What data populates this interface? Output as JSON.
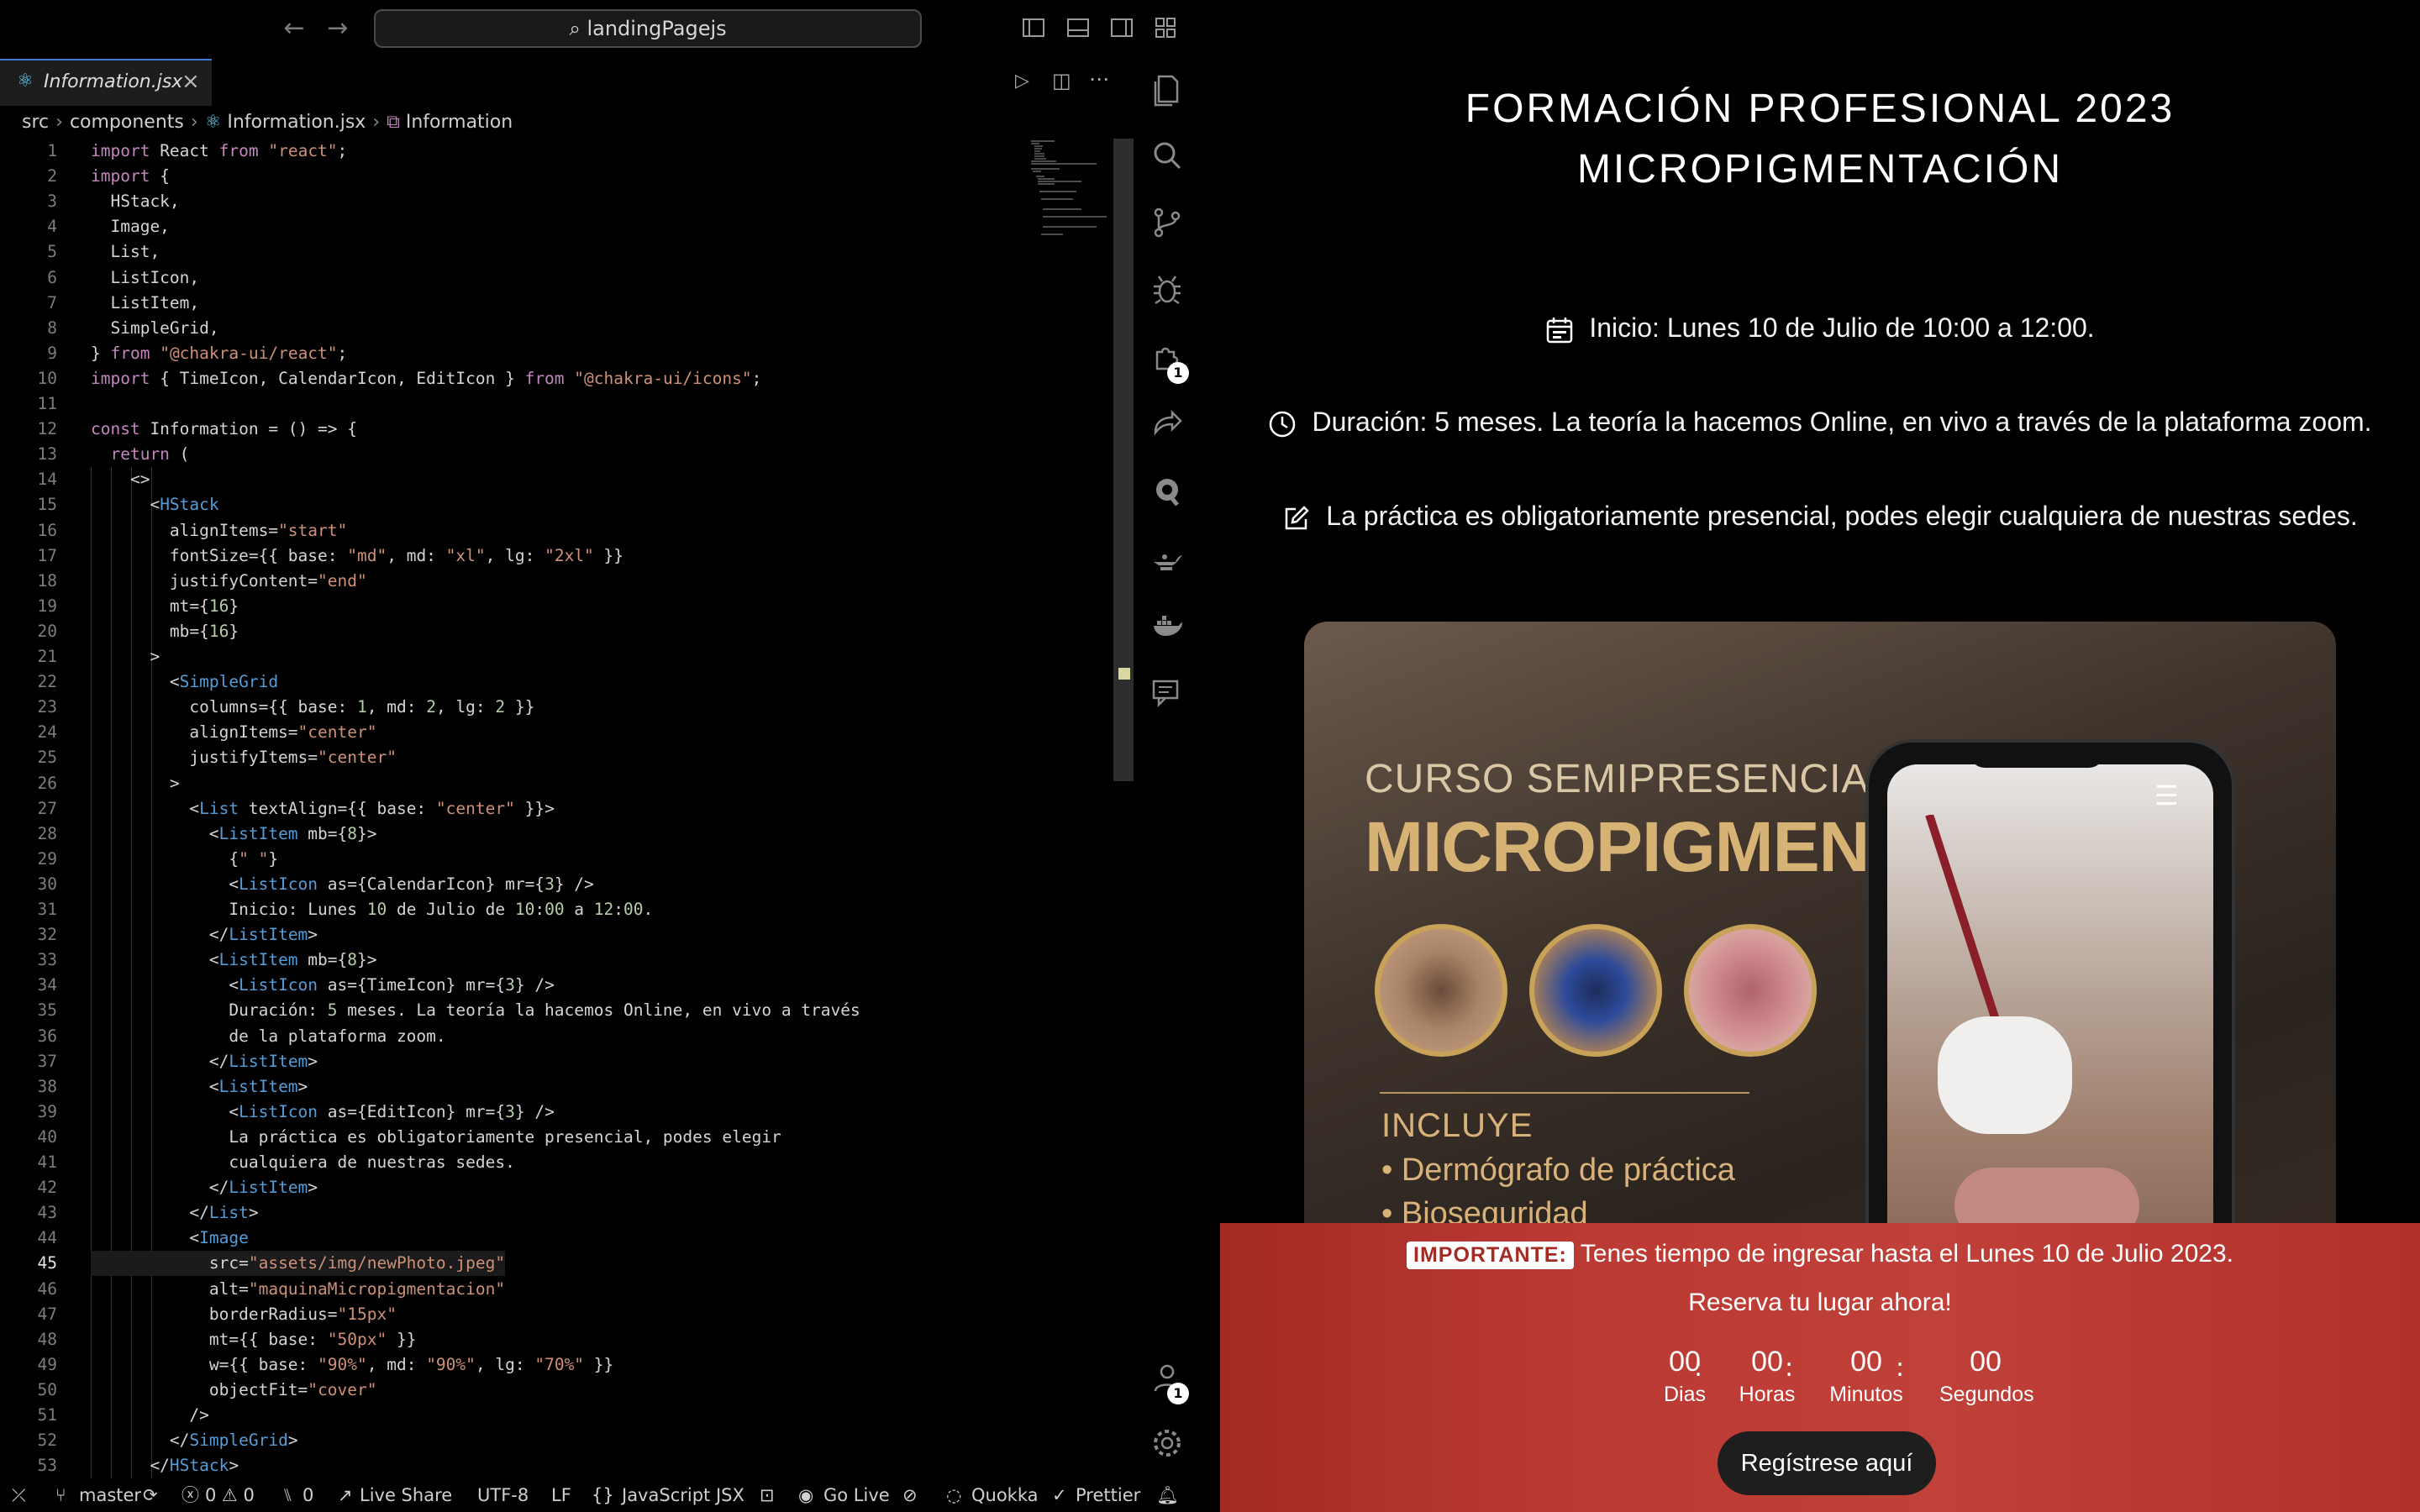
{
  "titlebar": {
    "search_text": "landingPagejs"
  },
  "tab": {
    "label": "Information.jsx"
  },
  "breadcrumb": {
    "p1": "src",
    "p2": "components",
    "p3": "Information.jsx",
    "p4": "Information"
  },
  "code_lines": [
    "import React from \"react\";",
    "import {",
    "  HStack,",
    "  Image,",
    "  List,",
    "  ListIcon,",
    "  ListItem,",
    "  SimpleGrid,",
    "} from \"@chakra-ui/react\";",
    "import { TimeIcon, CalendarIcon, EditIcon } from \"@chakra-ui/icons\";",
    "",
    "const Information = () => {",
    "  return (",
    "    <>",
    "      <HStack",
    "        alignItems=\"start\"",
    "        fontSize={{ base: \"md\", md: \"xl\", lg: \"2xl\" }}",
    "        justifyContent=\"end\"",
    "        mt={16}",
    "        mb={16}",
    "      >",
    "        <SimpleGrid",
    "          columns={{ base: 1, md: 2, lg: 2 }}",
    "          alignItems=\"center\"",
    "          justifyItems=\"center\"",
    "        >",
    "          <List textAlign={{ base: \"center\" }}>",
    "            <ListItem mb={8}>",
    "              {\" \"}",
    "              <ListIcon as={CalendarIcon} mr={3} />",
    "              Inicio: Lunes 10 de Julio de 10:00 a 12:00.",
    "            </ListItem>",
    "            <ListItem mb={8}>",
    "              <ListIcon as={TimeIcon} mr={3} />",
    "              Duración: 5 meses. La teoría la hacemos Online, en vivo a través",
    "              de la plataforma zoom.",
    "            </ListItem>",
    "            <ListItem>",
    "              <ListIcon as={EditIcon} mr={3} />",
    "              La práctica es obligatoriamente presencial, podes elegir",
    "              cualquiera de nuestras sedes.",
    "            </ListItem>",
    "          </List>",
    "          <Image",
    "            src=\"assets/img/newPhoto.jpeg\"",
    "            alt=\"maquinaMicropigmentacion\"",
    "            borderRadius=\"15px\"",
    "            mt={{ base: \"50px\" }}",
    "            w={{ base: \"90%\", md: \"90%\", lg: \"70%\" }}",
    "            objectFit=\"cover\"",
    "          />",
    "        </SimpleGrid>",
    "      </HStack>"
  ],
  "current_line": 45,
  "activity_badges": {
    "extensions": "1",
    "accounts": "1"
  },
  "statusbar": {
    "branch": "master",
    "problems": "0 ⚠ 0",
    "ports": "0",
    "live_share": "Live Share",
    "encoding": "UTF-8",
    "eol": "LF",
    "language": "JavaScript JSX",
    "go_live": "Go Live",
    "quokka": "Quokka",
    "prettier": "Prettier"
  },
  "preview": {
    "title_line1": "FORMACIÓN PROFESIONAL 2023",
    "title_line2": "MICROPIGMENTACIÓN",
    "items": [
      {
        "icon": "calendar-icon",
        "text": "Inicio: Lunes 10 de Julio de 10:00 a 12:00."
      },
      {
        "icon": "clock-icon",
        "text": "Duración: 5 meses. La teoría la hacemos Online, en vivo a través de la plataforma zoom."
      },
      {
        "icon": "edit-icon",
        "text": "La práctica es obligatoriamente presencial, podes elegir cualquiera de nuestras sedes."
      }
    ],
    "image": {
      "title_small": "CURSO SEMIPRESENCIAL",
      "title_big": "MICROPIGMENTACION",
      "incluye": "INCLUYE",
      "item1": "• Dermógrafo de práctica",
      "item2": "• Bioseguridad"
    },
    "banner": {
      "badge": "IMPORTANTE:",
      "line1": "Tenes tiempo de ingresar hasta el Lunes 10 de Julio 2023.",
      "line2": "Reserva tu lugar ahora!",
      "countdown": [
        {
          "value": "00",
          "label": "Dias"
        },
        {
          "value": "00",
          "label": "Horas"
        },
        {
          "value": "00",
          "label": "Minutos"
        },
        {
          "value": "00",
          "label": "Segundos"
        }
      ],
      "button": "Regístrese aquí"
    }
  },
  "colors": {
    "accent": "#3a7bd5",
    "banner": "#b8352e",
    "gold": "#d7b275"
  }
}
